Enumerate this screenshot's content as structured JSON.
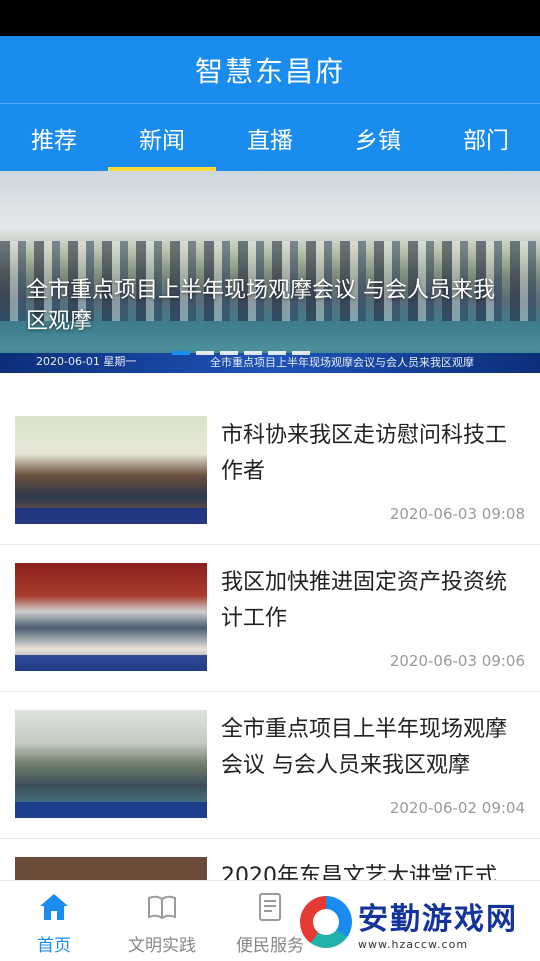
{
  "header": {
    "title": "智慧东昌府"
  },
  "tabs": [
    {
      "label": "推荐"
    },
    {
      "label": "新闻"
    },
    {
      "label": "直播"
    },
    {
      "label": "乡镇"
    },
    {
      "label": "部门"
    }
  ],
  "banner": {
    "caption": "全市重点项目上半年现场观摩会议  与会人员来我区观摩",
    "strip_text": "全市重点项目上半年现场观摩会议与会人员来我区观摩",
    "date": "2020-06-01 星期一"
  },
  "news": [
    {
      "title": "市科协来我区走访慰问科技工作者",
      "time": "2020-06-03 09:08"
    },
    {
      "title": "我区加快推进固定资产投资统计工作",
      "time": "2020-06-03 09:06"
    },
    {
      "title": "全市重点项目上半年现场观摩会议  与会人员来我区观摩",
      "time": "2020-06-02 09:04"
    },
    {
      "title": "2020年东昌文艺大讲堂正式",
      "time": ""
    }
  ],
  "bottom_nav": [
    {
      "label": "首页",
      "icon": "home-icon"
    },
    {
      "label": "文明实践",
      "icon": "book-icon"
    },
    {
      "label": "便民服务",
      "icon": "document-icon"
    }
  ],
  "watermark": {
    "title": "安勤游戏网",
    "url": "www.hzaccw.com"
  },
  "colors": {
    "primary": "#1a8cf0",
    "tab_indicator": "#ffd83a"
  }
}
